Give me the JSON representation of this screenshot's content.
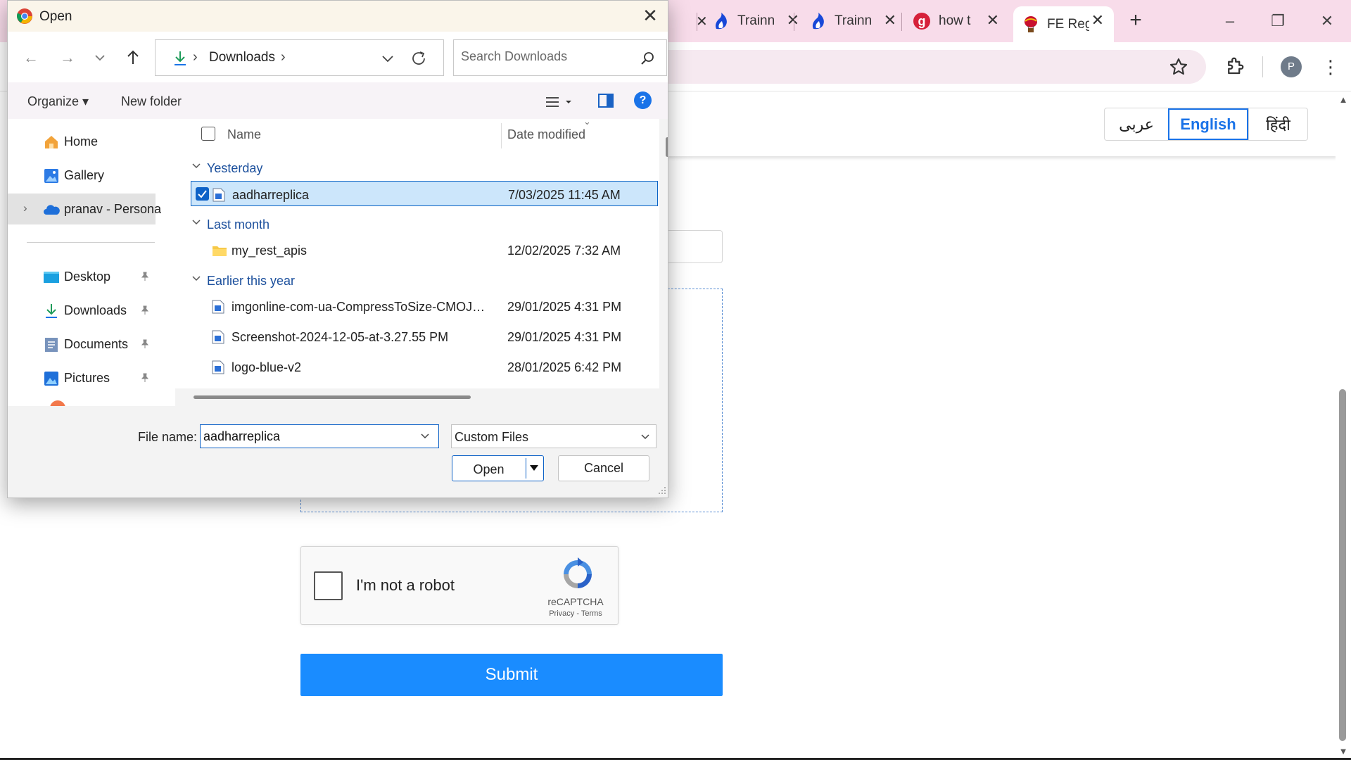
{
  "browser": {
    "tabs": [
      {
        "title": "Trainn",
        "favicon": "flame-icon"
      },
      {
        "title": "Trainn",
        "favicon": "flame-icon"
      },
      {
        "title": "how t",
        "favicon": "g-icon"
      },
      {
        "title": "FE Reg",
        "favicon": "balloon-icon",
        "active": true
      }
    ],
    "tab_close_glyph": "✕",
    "new_tab_glyph": "+",
    "profile_initial": "P",
    "accent_color": "#f8dcea"
  },
  "page": {
    "languages": [
      "عربى",
      "English",
      "हिंदी"
    ],
    "active_language": "English",
    "recaptcha": {
      "label": "I'm not a robot",
      "brand": "reCAPTCHA",
      "links": "Privacy - Terms"
    },
    "submit_label": "Submit",
    "submit_color": "#1a8cff"
  },
  "dialog": {
    "title": "Open",
    "address": {
      "segment": "Downloads",
      "chevron": "›"
    },
    "search_placeholder": "Search Downloads",
    "commandbar": {
      "organize": "Organize ▾",
      "new_folder": "New folder",
      "help": "?"
    },
    "nav_pane": {
      "items": [
        {
          "label": "Home",
          "icon": "home-icon"
        },
        {
          "label": "Gallery",
          "icon": "gallery-icon"
        },
        {
          "label": "pranav - Personal",
          "icon": "onedrive-icon",
          "selected": true
        },
        {
          "label": "Desktop",
          "icon": "desktop-icon",
          "pinned": true
        },
        {
          "label": "Downloads",
          "icon": "downloads-icon",
          "pinned": true
        },
        {
          "label": "Documents",
          "icon": "documents-icon",
          "pinned": true
        },
        {
          "label": "Pictures",
          "icon": "pictures-icon",
          "pinned": true
        }
      ]
    },
    "columns": {
      "name": "Name",
      "date": "Date modified"
    },
    "groups": [
      {
        "label": "Yesterday",
        "files": [
          {
            "name": "aadharreplica",
            "date": "7/03/2025 11:45 AM",
            "type": "image",
            "selected": true
          }
        ]
      },
      {
        "label": "Last month",
        "files": [
          {
            "name": "my_rest_apis",
            "date": "12/02/2025 7:32 AM",
            "type": "folder"
          }
        ]
      },
      {
        "label": "Earlier this year",
        "files": [
          {
            "name": "imgonline-com-ua-CompressToSize-CMOJAi...",
            "date": "29/01/2025 4:31 PM",
            "type": "image"
          },
          {
            "name": "Screenshot-2024-12-05-at-3.27.55 PM",
            "date": "29/01/2025 4:31 PM",
            "type": "image"
          },
          {
            "name": "logo-blue-v2",
            "date": "28/01/2025 6:42 PM",
            "type": "image"
          }
        ]
      }
    ],
    "footer": {
      "filename_label": "File name:",
      "filename_value": "aadharreplica",
      "filetype_value": "Custom Files",
      "open_label": "Open",
      "cancel_label": "Cancel"
    },
    "close_glyph": "✕"
  }
}
